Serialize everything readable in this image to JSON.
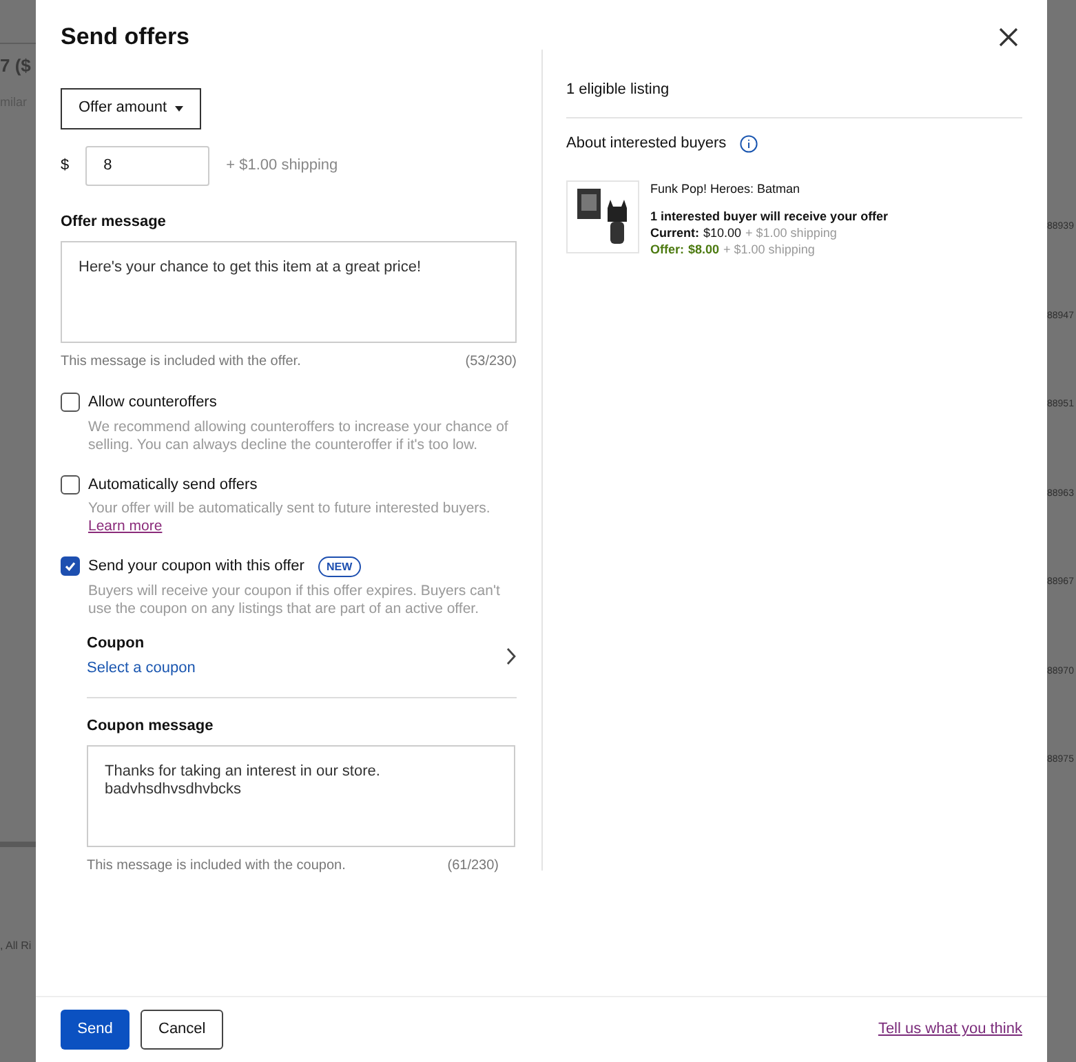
{
  "background": {
    "left_fragments": [
      "7 ($",
      "milar",
      ", All Ri"
    ],
    "right_fragments": [
      "88939",
      "88947",
      "88951",
      "88963",
      "88967",
      "88970",
      "88975"
    ]
  },
  "dialog": {
    "title": "Send offers",
    "offer_type": {
      "label": "Offer amount"
    },
    "amount": {
      "currency": "$",
      "value": "8",
      "shipping": "+ $1.00 shipping"
    },
    "offer_message": {
      "label": "Offer message",
      "value": "Here's your chance to get this item at a great price!",
      "hint": "This message is included with the offer.",
      "count": "(53/230)"
    },
    "options": [
      {
        "label": "Allow counteroffers",
        "checked": false,
        "description": "We recommend allowing counteroffers to increase your chance of selling. You can always decline the counteroffer if it's too low."
      },
      {
        "label": "Automatically send offers",
        "checked": false,
        "description": "Your offer will be automatically sent to future interested buyers.",
        "link": "Learn more"
      },
      {
        "label": "Send your coupon with this offer",
        "checked": true,
        "badge": "NEW",
        "description": "Buyers will receive your coupon if this offer expires. Buyers can't use the coupon on any listings that are part of an active offer."
      }
    ],
    "coupon": {
      "label": "Coupon",
      "action": "Select a coupon"
    },
    "coupon_message": {
      "label": "Coupon message",
      "lines": [
        "Thanks for taking an interest in our store.",
        "badvhsdhvsdhvbcks"
      ],
      "hint": "This message is included with the coupon.",
      "count": "(61/230)"
    },
    "listing_count": "1 eligible listing",
    "buyers_heading": "About interested buyers",
    "listing": {
      "title": "Funk Pop! Heroes: Batman",
      "buyers": "1 interested buyer will receive your offer",
      "current_label": "Current:",
      "current_price": "$10.00",
      "current_shipping": "+ $1.00 shipping",
      "offer_label": "Offer:",
      "offer_price": "$8.00",
      "offer_shipping": "+ $1.00 shipping"
    },
    "buttons": [
      {
        "label": "Send",
        "kind": "primary"
      },
      {
        "label": "Cancel",
        "kind": "secondary"
      }
    ],
    "feedback_link": "Tell us what you think"
  }
}
